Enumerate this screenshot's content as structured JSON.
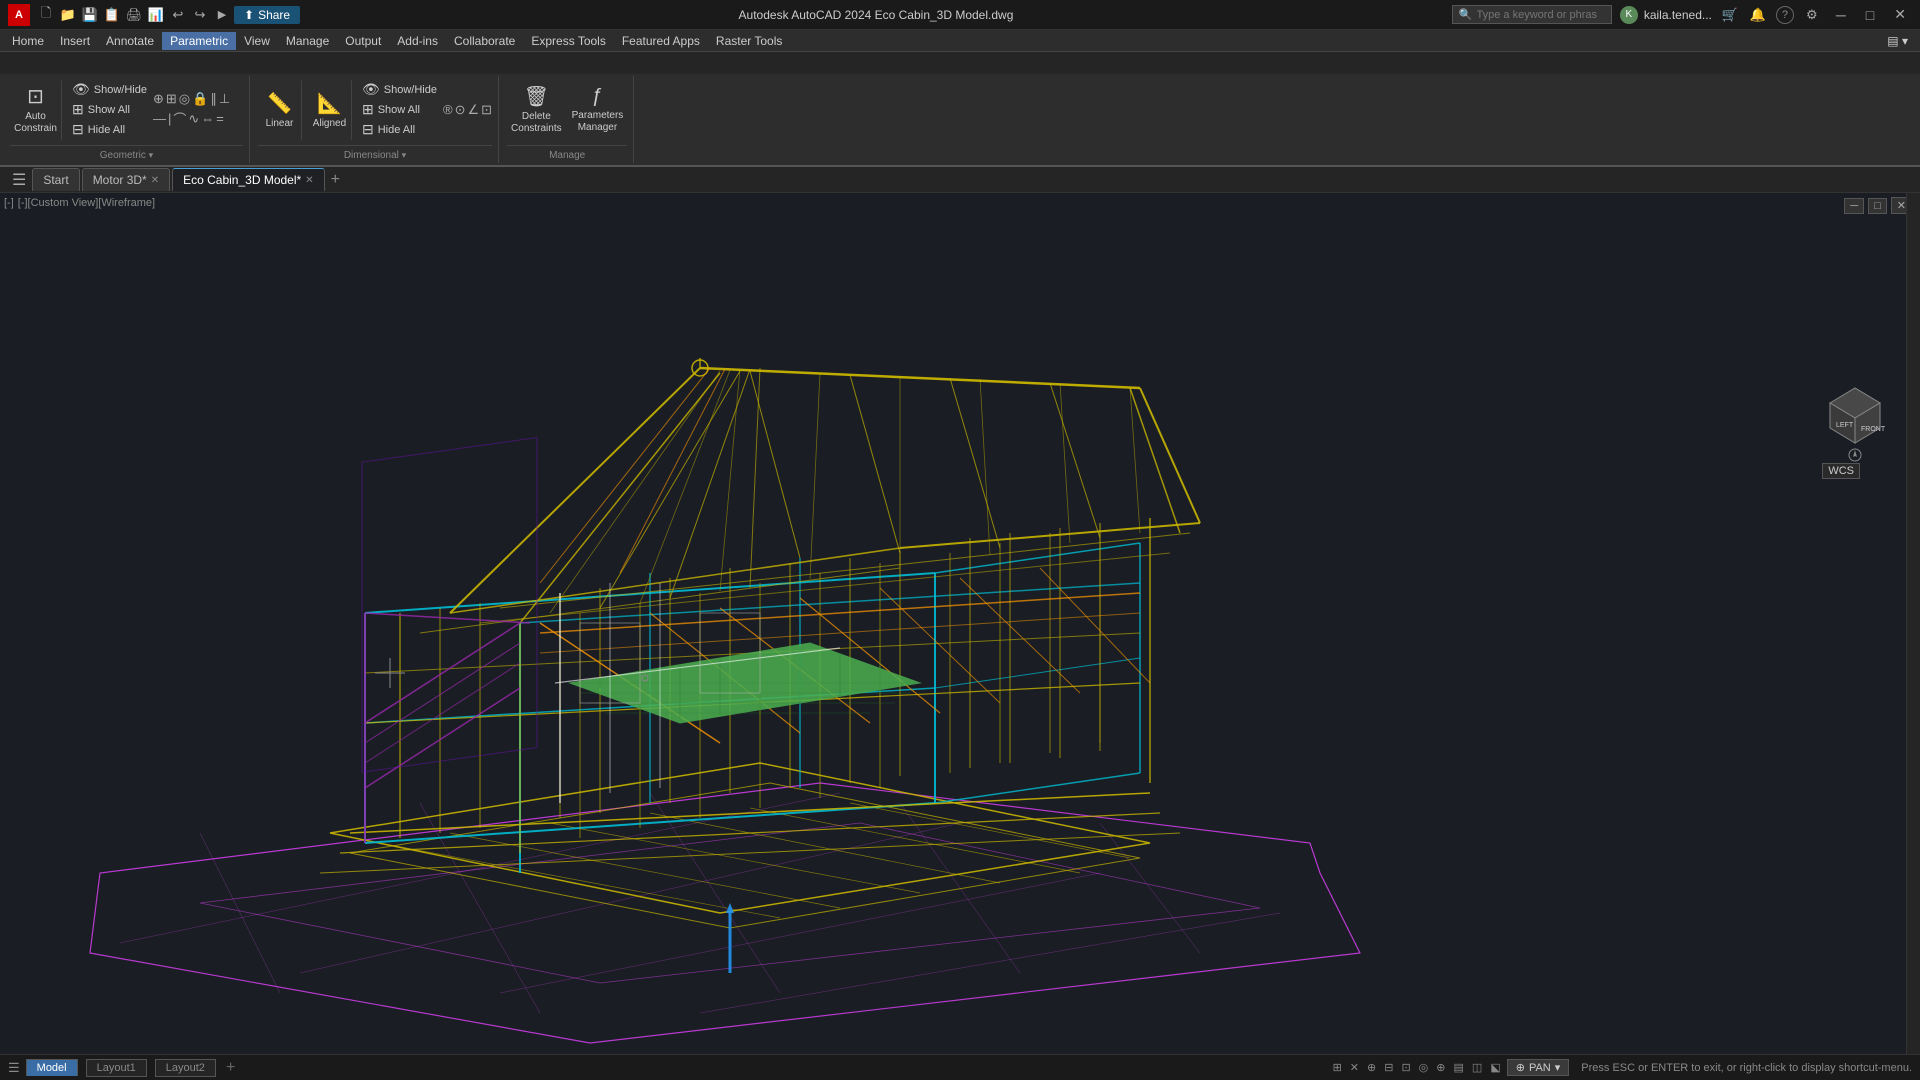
{
  "titlebar": {
    "app_name": "Autodesk AutoCAD 2024",
    "file_name": "Eco Cabin_3D Model.dwg",
    "full_title": "Autodesk AutoCAD 2024  Eco Cabin_3D Model.dwg",
    "share_label": "Share",
    "search_placeholder": "Type a keyword or phrase",
    "user_name": "kaila.tened...",
    "minimize": "─",
    "maximize": "□",
    "close": "✕"
  },
  "menu": {
    "items": [
      "Home",
      "Insert",
      "Annotate",
      "Parametric",
      "View",
      "Manage",
      "Output",
      "Add-ins",
      "Collaborate",
      "Express Tools",
      "Featured Apps",
      "Raster Tools"
    ]
  },
  "ribbon": {
    "active_tab": "Parametric",
    "tabs": [
      "Home",
      "Insert",
      "Annotate",
      "Parametric",
      "View",
      "Manage",
      "Output",
      "Add-ins",
      "Collaborate",
      "Express Tools",
      "Featured Apps",
      "Raster Tools"
    ],
    "groups": {
      "geometric": {
        "title": "Geometric",
        "buttons": {
          "auto_constrain": "Auto\nConstrain",
          "show_hide_geo": "Show/Hide",
          "show_all_geo": "Show All",
          "hide_all_geo": "Hide All"
        }
      },
      "dimensional": {
        "title": "Dimensional",
        "linear": "Linear",
        "aligned": "Aligned",
        "show_hide_dim": "Show/Hide",
        "show_all_dim": "Show All",
        "hide_all_dim": "Hide All"
      },
      "manage": {
        "title": "Manage",
        "delete": "Delete\nConstraints",
        "parameters": "Parameters\nManager"
      }
    }
  },
  "doc_tabs": {
    "menu_icon": "☰",
    "tabs": [
      {
        "label": "Start",
        "closable": false,
        "active": false
      },
      {
        "label": "Motor 3D*",
        "closable": true,
        "active": false
      },
      {
        "label": "Eco Cabin_3D Model*",
        "closable": true,
        "active": true
      }
    ],
    "add_label": "+"
  },
  "viewport": {
    "label": "[-][Custom View][Wireframe]",
    "view_menu": "☰",
    "controls": [
      "─",
      "□",
      "✕"
    ],
    "wcs": "WCS",
    "viewcube": {
      "left": "LEFT",
      "front": "FRONT"
    }
  },
  "status_bar": {
    "model_tab": "Model",
    "layout1": "Layout1",
    "layout2": "Layout2",
    "add_layout": "+",
    "pan_label": "PAN",
    "status_message": "Press ESC or ENTER to exit, or right-click to display shortcut-menu.",
    "icons": [
      "⊞",
      "✕",
      "⊕",
      "▾",
      "⊟",
      "⊠",
      "◈",
      "◉",
      "◎",
      "⊕",
      "☰"
    ]
  },
  "colors": {
    "accent_blue": "#4a9eda",
    "bg_dark": "#1a1e24",
    "bg_panel": "#2d2d2d",
    "yellow_wire": "#c8b400",
    "cyan_wire": "#00bcd4",
    "green_wire": "#4caf50",
    "magenta_wire": "#e040fb",
    "orange_wire": "#ff9800",
    "purple_wire": "#9c27b0",
    "white_wire": "#ffffff",
    "blue_wire": "#2196f3"
  }
}
